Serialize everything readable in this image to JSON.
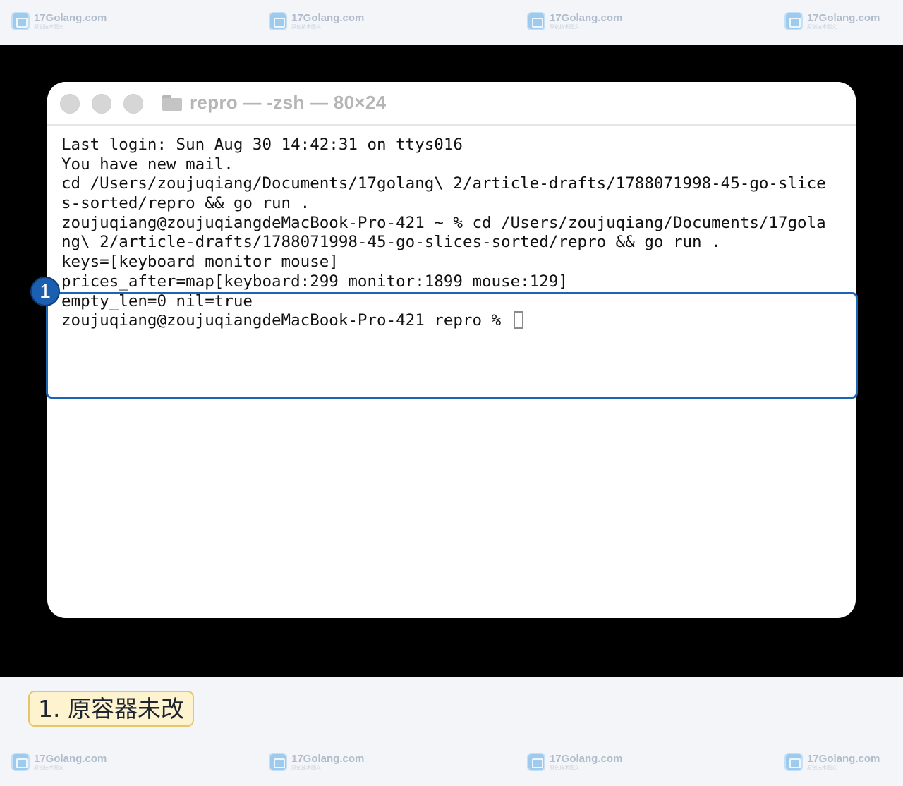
{
  "watermark": {
    "name": "17Golang.com",
    "sub": "原创技术图文"
  },
  "window": {
    "title": "repro — -zsh — 80×24"
  },
  "terminal": {
    "lines": [
      "Last login: Sun Aug 30 14:42:31 on ttys016",
      "You have new mail.",
      "cd /Users/zoujuqiang/Documents/17golang\\ 2/article-drafts/1788071998-45-go-slice",
      "s-sorted/repro && go run .",
      "zoujuqiang@zoujuqiangdeMacBook-Pro-421 ~ % cd /Users/zoujuqiang/Documents/17gola",
      "ng\\ 2/article-drafts/1788071998-45-go-slices-sorted/repro && go run .",
      "keys=[keyboard monitor mouse]",
      "prices_after=map[keyboard:299 monitor:1899 mouse:129]",
      "empty_len=0 nil=true",
      "zoujuqiang@zoujuqiangdeMacBook-Pro-421 repro % "
    ]
  },
  "annotation": {
    "badge": "1",
    "caption": "1. 原容器未改",
    "accent": "#1a5fb0"
  }
}
